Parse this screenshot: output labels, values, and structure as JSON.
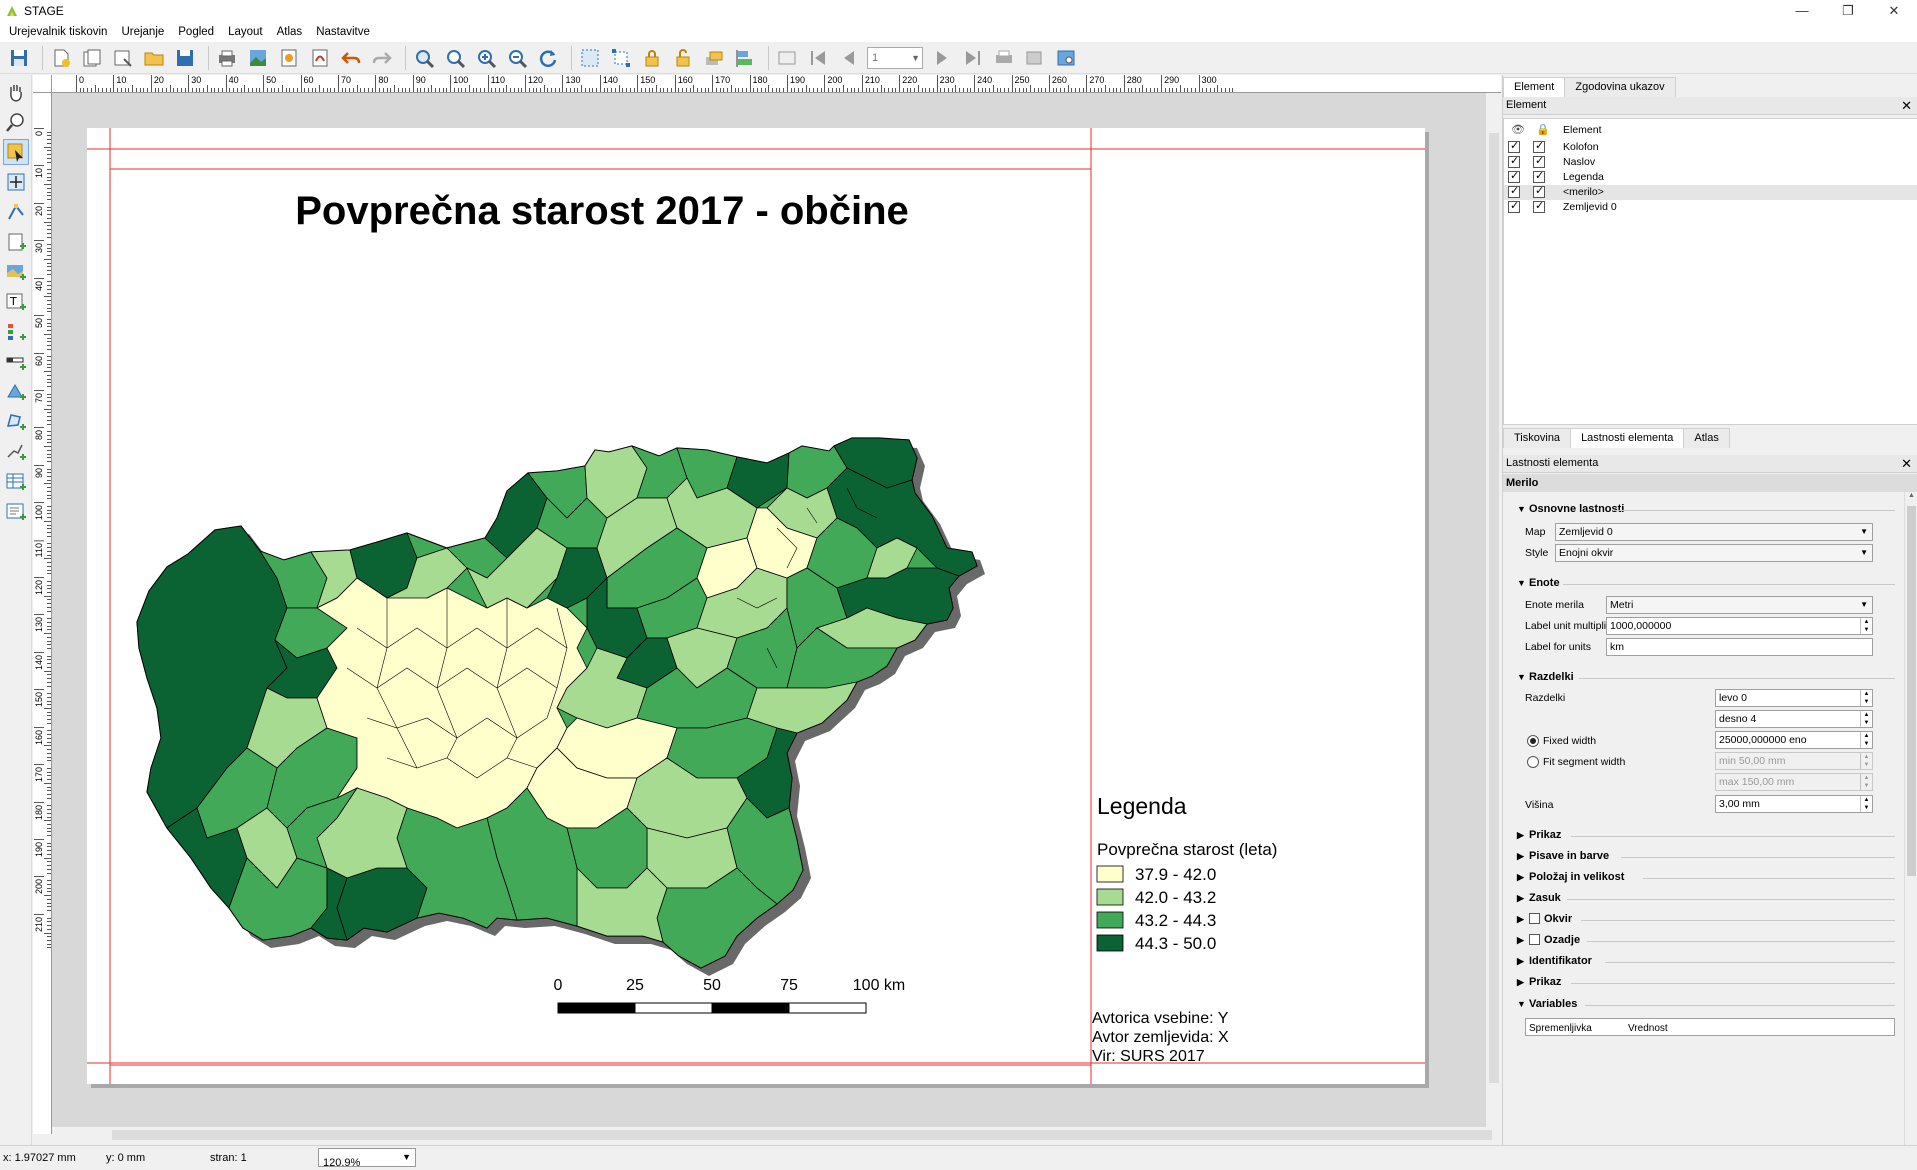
{
  "window": {
    "title": "STAGE",
    "minimize": "—",
    "restore": "❐",
    "close": "✕"
  },
  "menu": [
    "Urejevalnik tiskovin",
    "Urejanje",
    "Pogled",
    "Layout",
    "Atlas",
    "Nastavitve"
  ],
  "toolbar": {
    "page_number": "1"
  },
  "ruler": {
    "h_labels": [
      "0",
      "10",
      "20",
      "30",
      "40",
      "50",
      "60",
      "70",
      "80",
      "90",
      "100",
      "110",
      "120",
      "130",
      "140",
      "150",
      "160",
      "170",
      "180",
      "190",
      "200",
      "210",
      "220",
      "230",
      "240",
      "250",
      "260",
      "270",
      "280",
      "290",
      "300"
    ],
    "v_labels": [
      "0",
      "10",
      "20",
      "30",
      "40",
      "50",
      "60",
      "70",
      "80",
      "90",
      "100",
      "110",
      "120",
      "130",
      "140",
      "150",
      "160",
      "170",
      "180",
      "190",
      "200",
      "210"
    ]
  },
  "layout": {
    "title": "Povprečna starost 2017 - občine",
    "legend": {
      "heading": "Legenda",
      "subtitle": "Povprečna starost (leta)",
      "classes": [
        {
          "label": "37.9 - 42.0",
          "color": "#ffffcc"
        },
        {
          "label": "42.0 - 43.2",
          "color": "#a7db91"
        },
        {
          "label": "43.2 - 44.3",
          "color": "#41a958"
        },
        {
          "label": "44.3 - 50.0",
          "color": "#0b6233"
        }
      ]
    },
    "scalebar": {
      "labels": [
        "0",
        "25",
        "50",
        "75",
        "100 km"
      ]
    },
    "credits": [
      "Avtorica vsebine: Y",
      "Avtor zemljevida: X",
      "Vir: SURS 2017"
    ]
  },
  "status": {
    "x": "x: 1.97027 mm",
    "y": "y: 0 mm",
    "page": "stran: 1",
    "zoom": "120.9%"
  },
  "items_panel": {
    "tabs": [
      "Element",
      "Zgodovina ukazov"
    ],
    "header": "Element",
    "column": "Element",
    "items": [
      {
        "label": "Kolofon"
      },
      {
        "label": "Naslov"
      },
      {
        "label": "Legenda"
      },
      {
        "label": "<merilo>"
      },
      {
        "label": "Zemljevid 0"
      }
    ]
  },
  "props_panel": {
    "tabs": [
      "Tiskovina",
      "Lastnosti elementa",
      "Atlas"
    ],
    "header": "Lastnosti elementa",
    "item_title": "Merilo",
    "main": {
      "title": "Osnovne lastnosti",
      "map_label": "Map",
      "map_value": "Zemljevid 0",
      "style_label": "Style",
      "style_value": "Enojni okvir"
    },
    "units": {
      "title": "Enote",
      "units_label": "Enote merila",
      "units_value": "Metri",
      "mult_label": "Label unit multiplier",
      "mult_value": "1000,000000",
      "label_label": "Label for units",
      "label_value": "km"
    },
    "segments": {
      "title": "Razdelki",
      "label": "Razdelki",
      "left": "levo 0",
      "right": "desno 4",
      "fixed_label": "Fixed width",
      "fixed_value": "25000,000000 eno",
      "fit_label": "Fit segment width",
      "min": "min 50,00 mm",
      "max": "max 150,00 mm",
      "height_label": "Višina",
      "height_value": "3,00 mm"
    },
    "collapsed": [
      "Prikaz",
      "Pisave in barve",
      "Položaj in velikost",
      "Zasuk",
      "Okvir",
      "Ozadje",
      "Identifikator",
      "Prikaz",
      "Variables"
    ],
    "vars_cols": [
      "Spremenljivka",
      "Vrednost"
    ]
  }
}
